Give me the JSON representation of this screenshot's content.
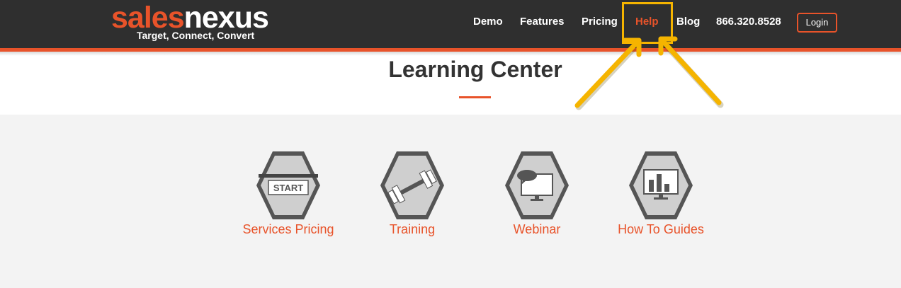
{
  "header": {
    "logo": {
      "word_left": "sales",
      "word_right": "nexus",
      "tagline": "Target, Connect, Convert"
    },
    "nav": {
      "demo": "Demo",
      "features": "Features",
      "pricing": "Pricing",
      "help": "Help",
      "blog": "Blog",
      "phone": "866.320.8528"
    },
    "login_label": "Login"
  },
  "page": {
    "title": "Learning Center"
  },
  "tiles": [
    {
      "label": "Services Pricing",
      "icon": "start-sign-icon",
      "icon_text": "START"
    },
    {
      "label": "Training",
      "icon": "dumbbell-icon"
    },
    {
      "label": "Webinar",
      "icon": "monitor-chat-icon"
    },
    {
      "label": "How To Guides",
      "icon": "bar-chart-monitor-icon"
    }
  ],
  "colors": {
    "header_bg": "#2f2f2f",
    "accent": "#e8532a",
    "highlight": "#f5b400",
    "content_bg": "#f3f3f3",
    "hex_icon_border": "#555555",
    "hex_icon_fill": "#cfcfcf"
  }
}
